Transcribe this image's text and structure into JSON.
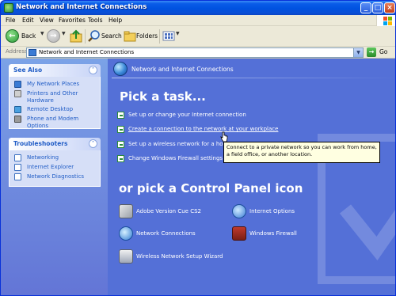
{
  "window": {
    "title": "Network and Internet Connections",
    "controls": {
      "minimize": "_",
      "maximize": "□",
      "close": "×"
    }
  },
  "menu": [
    "File",
    "Edit",
    "View",
    "Favorites",
    "Tools",
    "Help"
  ],
  "toolbar": {
    "back_label": "Back",
    "search_label": "Search",
    "folders_label": "Folders"
  },
  "address": {
    "label": "Address",
    "value": "Network and Internet Connections",
    "go_label": "Go"
  },
  "see_also": {
    "title": "See Also",
    "items": [
      {
        "label": "My Network Places",
        "icon": "network-places-icon"
      },
      {
        "label": "Printers and Other Hardware",
        "icon": "printer-icon"
      },
      {
        "label": "Remote Desktop",
        "icon": "remote-desktop-icon"
      },
      {
        "label": "Phone and Modem Options",
        "icon": "phone-icon"
      }
    ]
  },
  "troubleshooters": {
    "title": "Troubleshooters",
    "items": [
      {
        "label": "Networking"
      },
      {
        "label": "Internet Explorer"
      },
      {
        "label": "Network Diagnostics"
      }
    ]
  },
  "main": {
    "header": "Network and Internet Connections",
    "pick_task_title": "Pick a task...",
    "tasks": [
      {
        "label": "Set up or change your Internet connection"
      },
      {
        "label": "Create a connection to the network at your workplace"
      },
      {
        "label": "Set up a wireless network for a ho"
      },
      {
        "label": "Change Windows Firewall settings"
      }
    ],
    "tooltip": "Connect to a private network so you can work from home, a field office, or another location.",
    "pick_cp_title": "or pick a Control Panel icon",
    "cp_icons": [
      {
        "label": "Adobe Version Cue CS2",
        "icon": "adobe-version-cue-icon"
      },
      {
        "label": "Internet Options",
        "icon": "internet-options-icon"
      },
      {
        "label": "Network Connections",
        "icon": "network-connections-icon"
      },
      {
        "label": "Windows Firewall",
        "icon": "windows-firewall-icon"
      },
      {
        "label": "Wireless Network Setup Wizard",
        "icon": "wireless-wizard-icon"
      }
    ]
  },
  "colors": {
    "content_bg": "#5470d7",
    "task_pane_link": "#215dc6",
    "title_bar": "#0052e0"
  }
}
